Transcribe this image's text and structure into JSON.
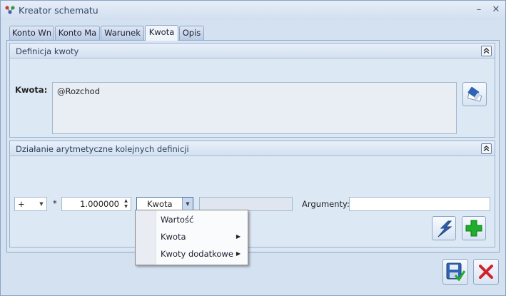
{
  "window": {
    "title": "Kreator schematu",
    "minimize": "–",
    "close": "✕"
  },
  "tabs": [
    {
      "label": "Konto Wn"
    },
    {
      "label": "Konto Ma"
    },
    {
      "label": "Warunek"
    },
    {
      "label": "Kwota",
      "active": true
    },
    {
      "label": "Opis"
    }
  ],
  "definition_group": {
    "title": "Definicja kwoty",
    "amount_label": "Kwota:",
    "amount_value": "@Rozchod",
    "edit_icon": "eraser-edit-icon"
  },
  "arithmetic_group": {
    "title": "Działanie arytmetyczne kolejnych definicji",
    "operator_value": "+",
    "multiply_symbol": "*",
    "multiplier_value": "1.000000",
    "source_value": "Kwota",
    "arguments_label": "Argumenty:",
    "arguments_value": "",
    "second_field_value": ""
  },
  "dropdown_menu": {
    "items": [
      {
        "label": "Wartość",
        "submenu": false
      },
      {
        "label": "Kwota",
        "submenu": true
      },
      {
        "label": "Kwoty dodatkowe",
        "submenu": true
      }
    ]
  },
  "footer": {
    "save_icon": "save-icon",
    "cancel_icon": "cancel-icon"
  },
  "colors": {
    "window_bg": "#d4e1f1",
    "add_green": "#1fae2b",
    "cancel_red": "#d0222a",
    "accent_blue": "#2f64b5"
  }
}
